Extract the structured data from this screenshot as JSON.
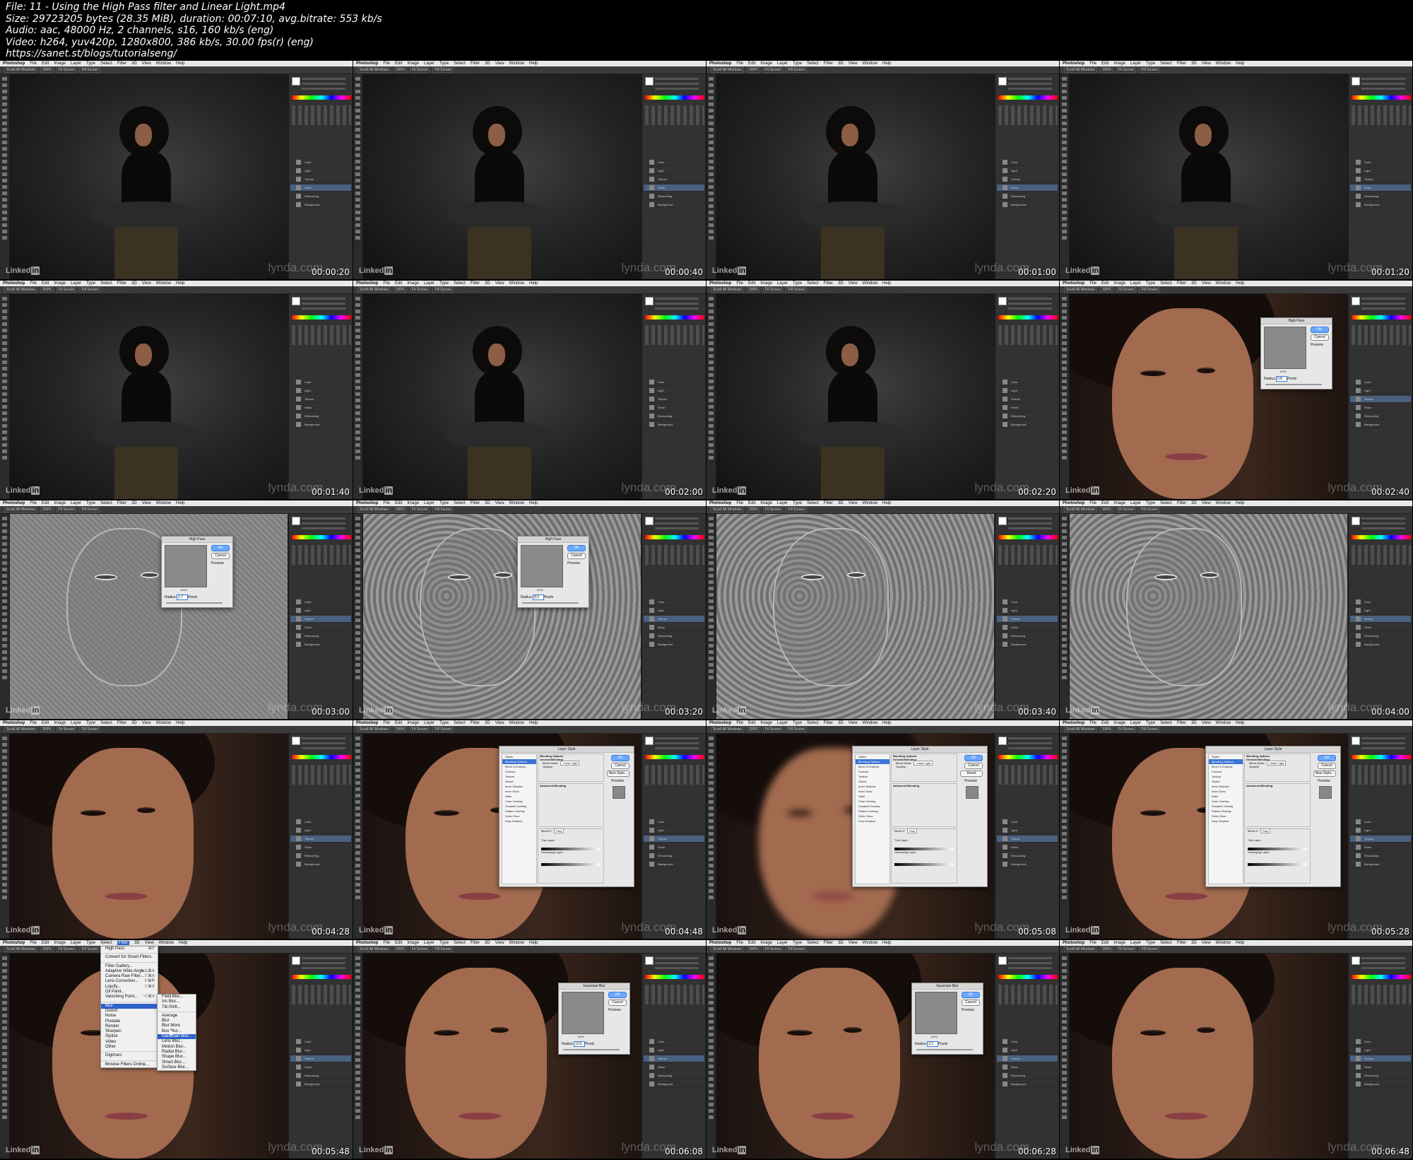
{
  "header": {
    "file_line": "File: 11 - Using the High Pass filter and Linear Light.mp4",
    "size_line": "Size: 29723205 bytes (28.35 MiB), duration: 00:07:10, avg.bitrate: 553 kb/s",
    "audio_line": "Audio: aac, 48000 Hz, 2 channels, s16, 160 kb/s (eng)",
    "video_line": "Video: h264, yuv420p, 1280x800, 386 kb/s, 30.00 fps(r) (eng)",
    "url_line": "https://sanet.st/blogs/tutorialseng/"
  },
  "photoshop": {
    "app_name": "Photoshop",
    "menus": [
      "File",
      "Edit",
      "Image",
      "Layer",
      "Type",
      "Select",
      "Filter",
      "3D",
      "View",
      "Window",
      "Help"
    ],
    "options": [
      "Scroll All Windows",
      "100%",
      "Fit Screen",
      "Fill Screen"
    ],
    "layers": [
      "Color",
      "Light",
      "Texture",
      "Shine",
      "Retouching",
      "Background"
    ]
  },
  "branding": {
    "linkedin_text": "Linked",
    "linkedin_in": "in",
    "lynda_text": "lynda.com"
  },
  "dialogs": {
    "high_pass": {
      "title": "High Pass",
      "ok": "OK",
      "cancel": "Cancel",
      "preview": "Preview",
      "zoom": "100%",
      "radius_label": "Radius:",
      "units": "Pixels"
    },
    "gaussian_blur": {
      "title": "Gaussian Blur",
      "ok": "OK",
      "cancel": "Cancel",
      "preview": "Preview",
      "zoom": "100%",
      "radius_label": "Radius:",
      "units": "Pixels"
    },
    "layer_style": {
      "title": "Layer Style",
      "ok": "OK",
      "cancel": "Cancel",
      "new_style": "New Style...",
      "preview": "Preview",
      "styles_header": "Styles",
      "list": [
        "Blending Options: Custom",
        "Bevel & Emboss",
        "Contour",
        "Texture",
        "Stroke",
        "Inner Shadow",
        "Inner Glow",
        "Satin",
        "Color Overlay",
        "Gradient Overlay",
        "Pattern Overlay",
        "Outer Glow",
        "Drop Shadow"
      ],
      "blending_options": "Blending Options",
      "general_blending": "General Blending",
      "blend_mode_label": "Blend Mode:",
      "blend_mode_value": "Linear Light",
      "opacity_label": "Opacity:",
      "advanced_blending": "Advanced Blending",
      "blend_if_label": "Blend If:",
      "blend_if_value": "Gray",
      "this_layer": "This Layer:",
      "underlying_layer": "Underlying Layer:"
    }
  },
  "filter_menu": {
    "items": [
      "High Pass",
      "Convert for Smart Filters",
      "Filter Gallery...",
      "Adaptive Wide Angle...",
      "Camera Raw Filter...",
      "Lens Correction...",
      "Liquify...",
      "Oil Paint...",
      "Vanishing Point...",
      "Blur",
      "Distort",
      "Noise",
      "Pixelate",
      "Render",
      "Sharpen",
      "Stylize",
      "Video",
      "Other",
      "Digimarc",
      "Browse Filters Online..."
    ],
    "shortcuts": [
      "⌘F",
      "",
      "",
      "⌥⇧⌘A",
      "⇧⌘A",
      "⇧⌘R",
      "⇧⌘X",
      "",
      "⌥⌘V"
    ]
  },
  "blur_submenu": {
    "items": [
      "Field Blur...",
      "Iris Blur...",
      "Tilt-Shift...",
      "Average",
      "Blur",
      "Blur More",
      "Box Blur...",
      "Gaussian Blur...",
      "Lens Blur...",
      "Motion Blur...",
      "Radial Blur...",
      "Shape Blur...",
      "Smart Blur...",
      "Surface Blur..."
    ]
  },
  "frames": [
    {
      "timestamp": "00:00:20",
      "scene": "studio",
      "radius": ""
    },
    {
      "timestamp": "00:00:40",
      "scene": "studio",
      "radius": ""
    },
    {
      "timestamp": "00:01:00",
      "scene": "studio",
      "radius": ""
    },
    {
      "timestamp": "00:01:20",
      "scene": "studio",
      "radius": ""
    },
    {
      "timestamp": "00:01:40",
      "scene": "studio",
      "radius": ""
    },
    {
      "timestamp": "00:02:00",
      "scene": "studio",
      "radius": ""
    },
    {
      "timestamp": "00:02:20",
      "scene": "studio",
      "radius": ""
    },
    {
      "timestamp": "00:02:40",
      "scene": "face-highpass",
      "radius": "0.8"
    },
    {
      "timestamp": "00:03:00",
      "scene": "highpass-dialog",
      "radius": "1.7"
    },
    {
      "timestamp": "00:03:20",
      "scene": "highpass-face-dialog",
      "radius": "8.0"
    },
    {
      "timestamp": "00:03:40",
      "scene": "highpass-face",
      "radius": ""
    },
    {
      "timestamp": "00:04:00",
      "scene": "highpass-face",
      "radius": ""
    },
    {
      "timestamp": "00:04:28",
      "scene": "face",
      "radius": ""
    },
    {
      "timestamp": "00:04:48",
      "scene": "face-layerstyle",
      "radius": "",
      "ls_right": "New Style..."
    },
    {
      "timestamp": "00:05:08",
      "scene": "blur-layerstyle",
      "radius": "",
      "ls_right": "Reset"
    },
    {
      "timestamp": "00:05:28",
      "scene": "face-layerstyle",
      "radius": "",
      "ls_right": "New Style..."
    },
    {
      "timestamp": "00:05:48",
      "scene": "face-filtermenu",
      "radius": ""
    },
    {
      "timestamp": "00:06:08",
      "scene": "face-gaussian",
      "radius": "13.6"
    },
    {
      "timestamp": "00:06:28",
      "scene": "face-gaussian",
      "radius": "3.2"
    },
    {
      "timestamp": "00:06:48",
      "scene": "face",
      "radius": ""
    }
  ]
}
